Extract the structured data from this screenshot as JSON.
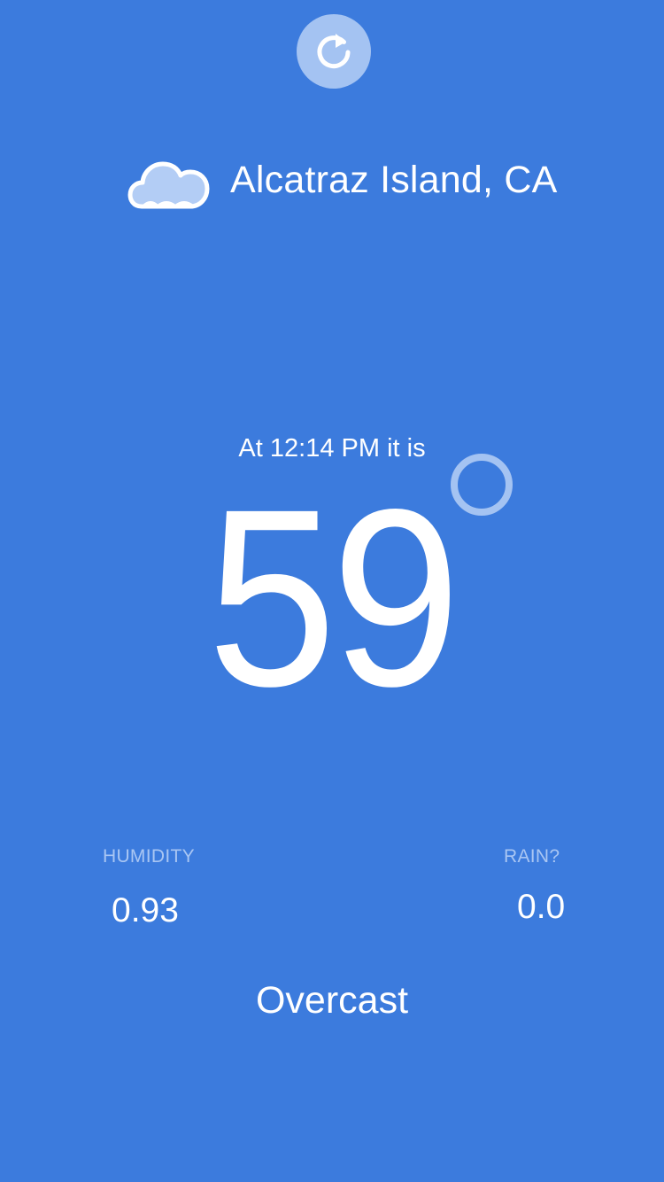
{
  "app": {
    "background_color": "#3c7bdd",
    "accent_color": "#a4c3f2"
  },
  "header": {
    "refresh_icon": "refresh-icon"
  },
  "location": {
    "icon": "cloud-icon",
    "name": "Alcatraz Island, CA"
  },
  "current": {
    "time_label": "At 12:14 PM it is",
    "temperature": "59",
    "degree_icon": "degree-ring-icon"
  },
  "stats": {
    "humidity_label": "HUMIDITY",
    "humidity_value": "0.93",
    "rain_label": "RAIN?",
    "rain_value": "0.0"
  },
  "summary": "Overcast"
}
